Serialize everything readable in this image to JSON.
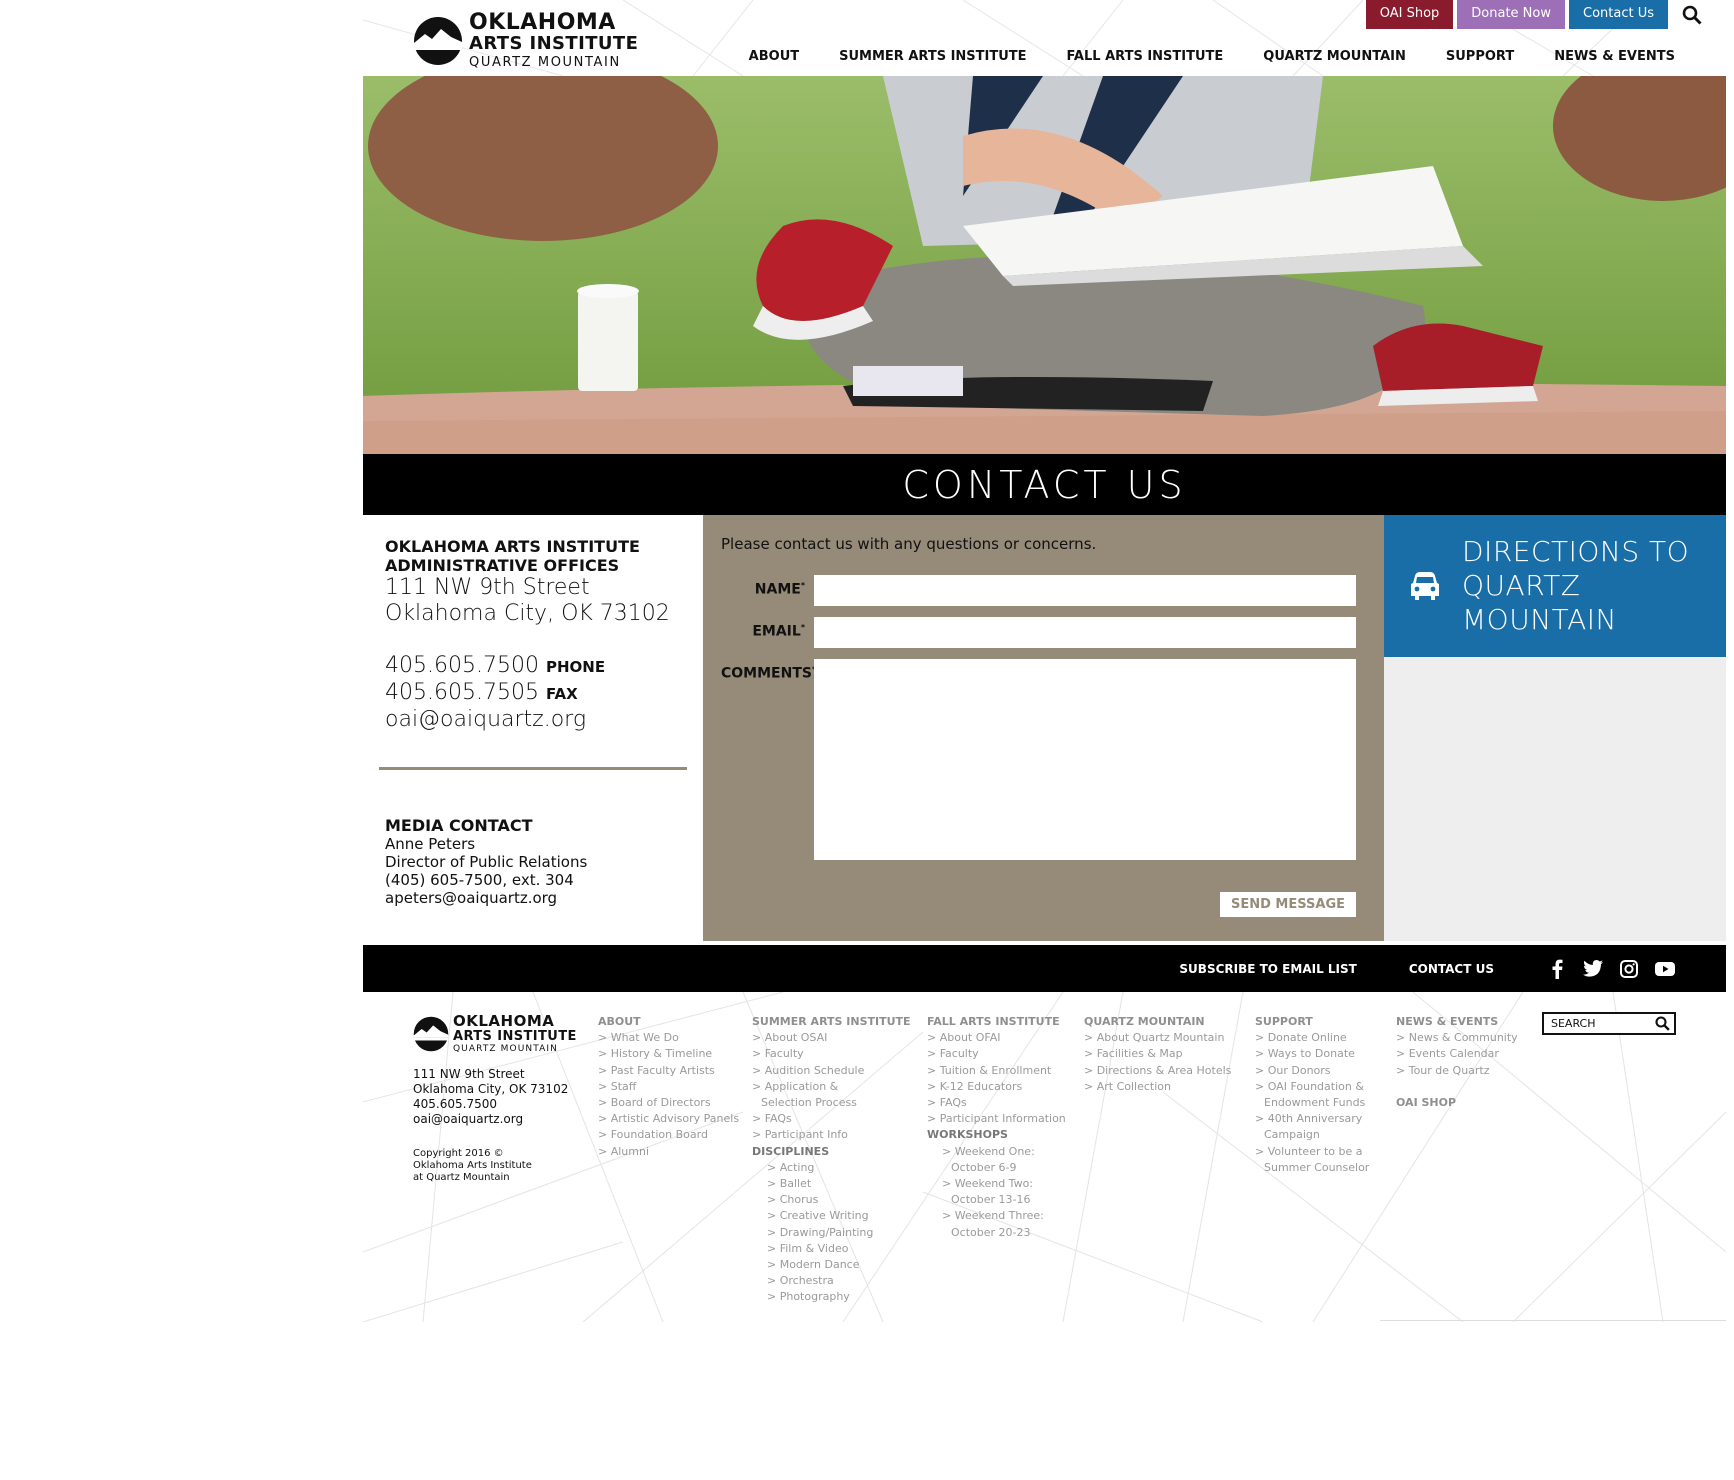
{
  "header": {
    "logo": {
      "line1": "OKLAHOMA",
      "line2": "ARTS INSTITUTE",
      "line3": "QUARTZ MOUNTAIN"
    },
    "top_buttons": {
      "shop": "OAI Shop",
      "donate": "Donate Now",
      "contact": "Contact Us"
    },
    "nav": [
      "ABOUT",
      "SUMMER ARTS INSTITUTE",
      "FALL ARTS INSTITUTE",
      "QUARTZ MOUNTAIN",
      "SUPPORT",
      "NEWS & EVENTS"
    ]
  },
  "page_title": "CONTACT US",
  "office": {
    "title1": "OKLAHOMA ARTS INSTITUTE",
    "title2": "ADMINISTRATIVE OFFICES",
    "street": "111 NW 9th Street",
    "city": "Oklahoma City, OK  73102",
    "phone": "405.605.7500",
    "phone_label": "PHONE",
    "fax": "405.605.7505",
    "fax_label": "FAX",
    "email": "oai@oaiquartz.org"
  },
  "media": {
    "title": "MEDIA CONTACT",
    "name": "Anne Peters",
    "role": "Director of Public Relations",
    "phone": "(405) 605-7500, ext. 304",
    "email": "apeters@oaiquartz.org"
  },
  "form": {
    "intro": "Please contact us with any questions or concerns.",
    "name_label": "NAME",
    "email_label": "EMAIL",
    "comments_label": "COMMENTS",
    "required_mark": "*",
    "name_value": "",
    "email_value": "",
    "comments_value": "",
    "submit": "SEND MESSAGE"
  },
  "directions": {
    "line1": "DIRECTIONS TO",
    "line2": "QUARTZ",
    "line3": "MOUNTAIN"
  },
  "footer_bar": {
    "subscribe": "SUBSCRIBE TO EMAIL LIST",
    "contact": "CONTACT US",
    "social": [
      "facebook-icon",
      "twitter-icon",
      "instagram-icon",
      "youtube-icon"
    ]
  },
  "footer": {
    "logo": {
      "line1": "OKLAHOMA",
      "line2": "ARTS INSTITUTE",
      "line3": "QUARTZ MOUNTAIN"
    },
    "address": [
      "111 NW 9th Street",
      "Oklahoma City, OK 73102",
      "405.605.7500",
      "oai@oaiquartz.org"
    ],
    "copyright": [
      "Copyright 2016 ©",
      "Oklahoma Arts Institute",
      "at Quartz Mountain"
    ],
    "about": {
      "heading": "ABOUT",
      "links": [
        "> What We Do",
        "> History & Timeline",
        "> Past Faculty Artists",
        "> Staff",
        "> Board of Directors",
        "> Artistic Advisory Panels",
        "> Foundation Board",
        "> Alumni"
      ]
    },
    "summer": {
      "heading": "SUMMER ARTS INSTITUTE",
      "links": [
        "> About OSAI",
        "> Faculty",
        "> Audition Schedule",
        "> Application &",
        "Selection Process",
        "> FAQs",
        "> Participant Info"
      ],
      "disciplines_heading": "DISCIPLINES",
      "disciplines": [
        "> Acting",
        "> Ballet",
        "> Chorus",
        "> Creative Writing",
        "> Drawing/Painting",
        "> Film & Video",
        "> Modern Dance",
        "> Orchestra",
        "> Photography"
      ]
    },
    "fall": {
      "heading": "FALL ARTS INSTITUTE",
      "links": [
        "> About OFAI",
        "> Faculty",
        "> Tuition & Enrollment",
        "> K-12 Educators",
        "> FAQs",
        "> Participant Information"
      ],
      "workshops_heading": "WORKSHOPS",
      "workshops": [
        "> Weekend One:",
        "October 6-9",
        "> Weekend Two:",
        "October 13-16",
        "> Weekend Three:",
        "October 20-23"
      ]
    },
    "quartz": {
      "heading": "QUARTZ MOUNTAIN",
      "links": [
        "> About Quartz Mountain",
        "> Facilities & Map",
        "> Directions & Area Hotels",
        "> Art Collection"
      ]
    },
    "support": {
      "heading": "SUPPORT",
      "links": [
        "> Donate Online",
        "> Ways to Donate",
        "> Our Donors",
        "> OAI Foundation &",
        "Endowment Funds",
        "> 40th Anniversary",
        "Campaign",
        "> Volunteer to be a",
        "Summer Counselor"
      ]
    },
    "news": {
      "heading": "NEWS & EVENTS",
      "links": [
        "> News & Community",
        "> Events Calendar",
        "> Tour de Quartz"
      ],
      "shop": "OAI SHOP"
    },
    "search_placeholder": "SEARCH"
  },
  "colors": {
    "shop": "#8a1b2c",
    "donate": "#9c6fb6",
    "contact": "#1a6ea7",
    "form_bg": "#968b79",
    "directions_bg": "#1a6ea7"
  }
}
